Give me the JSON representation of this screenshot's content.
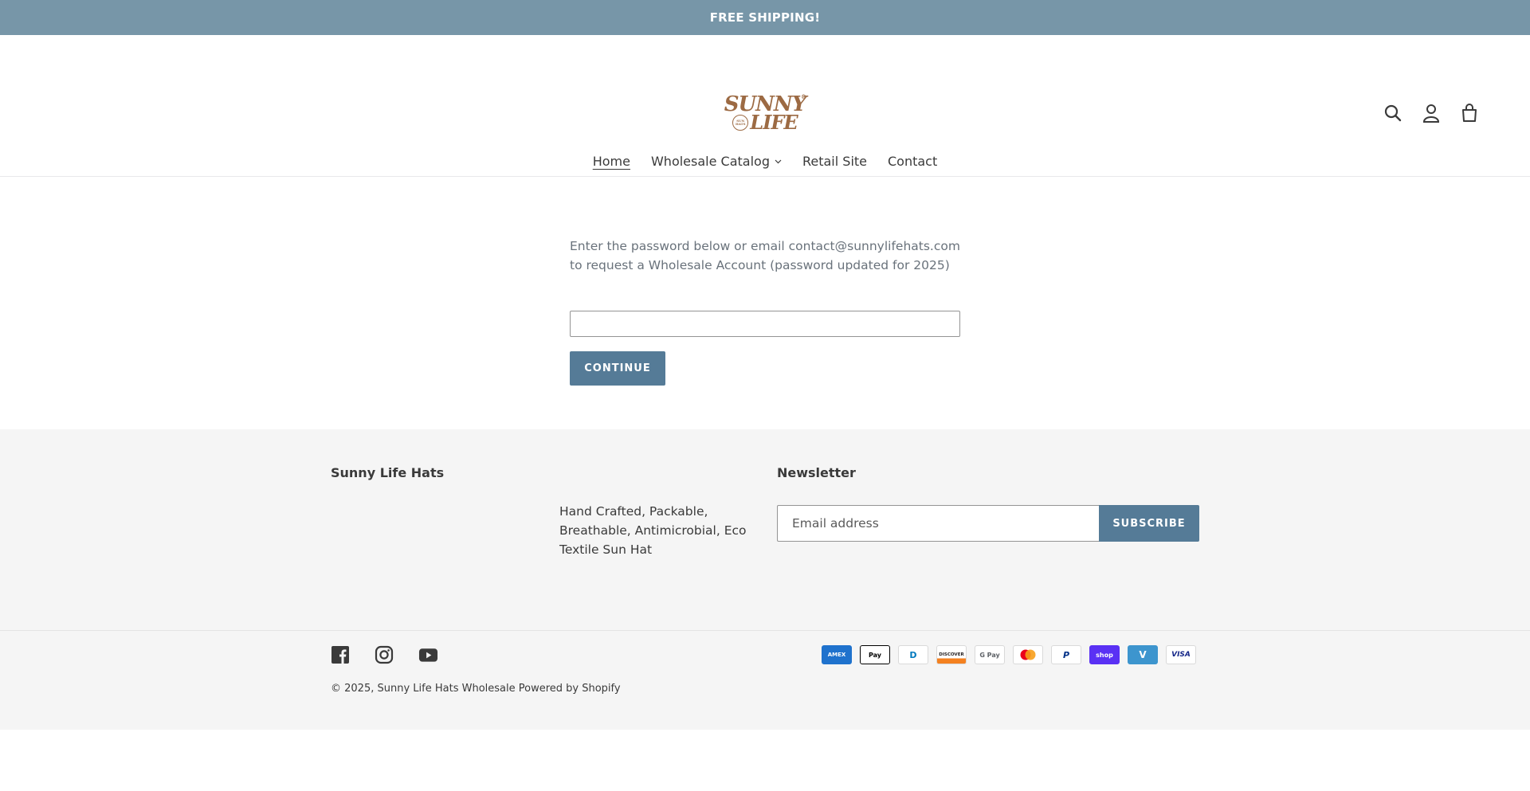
{
  "announcement": {
    "text": "FREE SHIPPING!"
  },
  "header": {
    "logo": {
      "line1": "SUNNY",
      "line2": "LIFE",
      "seal_top": "SUN",
      "seal_bottom": "HATS",
      "mark": "®"
    },
    "icons": [
      "search-icon",
      "account-icon",
      "cart-icon"
    ]
  },
  "nav": {
    "items": [
      {
        "label": "Home",
        "active": true
      },
      {
        "label": "Wholesale Catalog",
        "has_dropdown": true
      },
      {
        "label": "Retail Site"
      },
      {
        "label": "Contact"
      }
    ]
  },
  "password": {
    "message": "Enter the password below or email contact@sunnylifehats.com to request a Wholesale Account (password updated for 2025)",
    "input_value": "",
    "button_label": "CONTINUE"
  },
  "footer": {
    "brand_title": "Sunny Life Hats",
    "tagline": "Hand Crafted, Packable, Breathable, Antimicrobial, Eco Textile Sun Hat",
    "newsletter_title": "Newsletter",
    "email_placeholder": "Email address",
    "subscribe_label": "SUBSCRIBE",
    "social": [
      "facebook-icon",
      "instagram-icon",
      "youtube-icon"
    ],
    "copyright_prefix": "© 2025,",
    "shop_name": "Sunny Life Hats Wholesale",
    "powered_by": "Powered by Shopify",
    "payments": [
      {
        "name": "american-express-icon",
        "label": "AMEX"
      },
      {
        "name": "apple-pay-icon",
        "label": "Pay"
      },
      {
        "name": "diners-club-icon",
        "label": "D"
      },
      {
        "name": "discover-icon",
        "label": "DISCOVER"
      },
      {
        "name": "google-pay-icon",
        "label": "G Pay"
      },
      {
        "name": "mastercard-icon",
        "label": ""
      },
      {
        "name": "paypal-icon",
        "label": "P"
      },
      {
        "name": "shop-pay-icon",
        "label": "shop"
      },
      {
        "name": "venmo-icon",
        "label": "V"
      },
      {
        "name": "visa-icon",
        "label": "VISA"
      }
    ]
  },
  "colors": {
    "announcement_bg": "#7796a8",
    "button_bg": "#557b97",
    "logo_brown": "#9c6a43",
    "footer_bg": "#f5f5f5"
  }
}
